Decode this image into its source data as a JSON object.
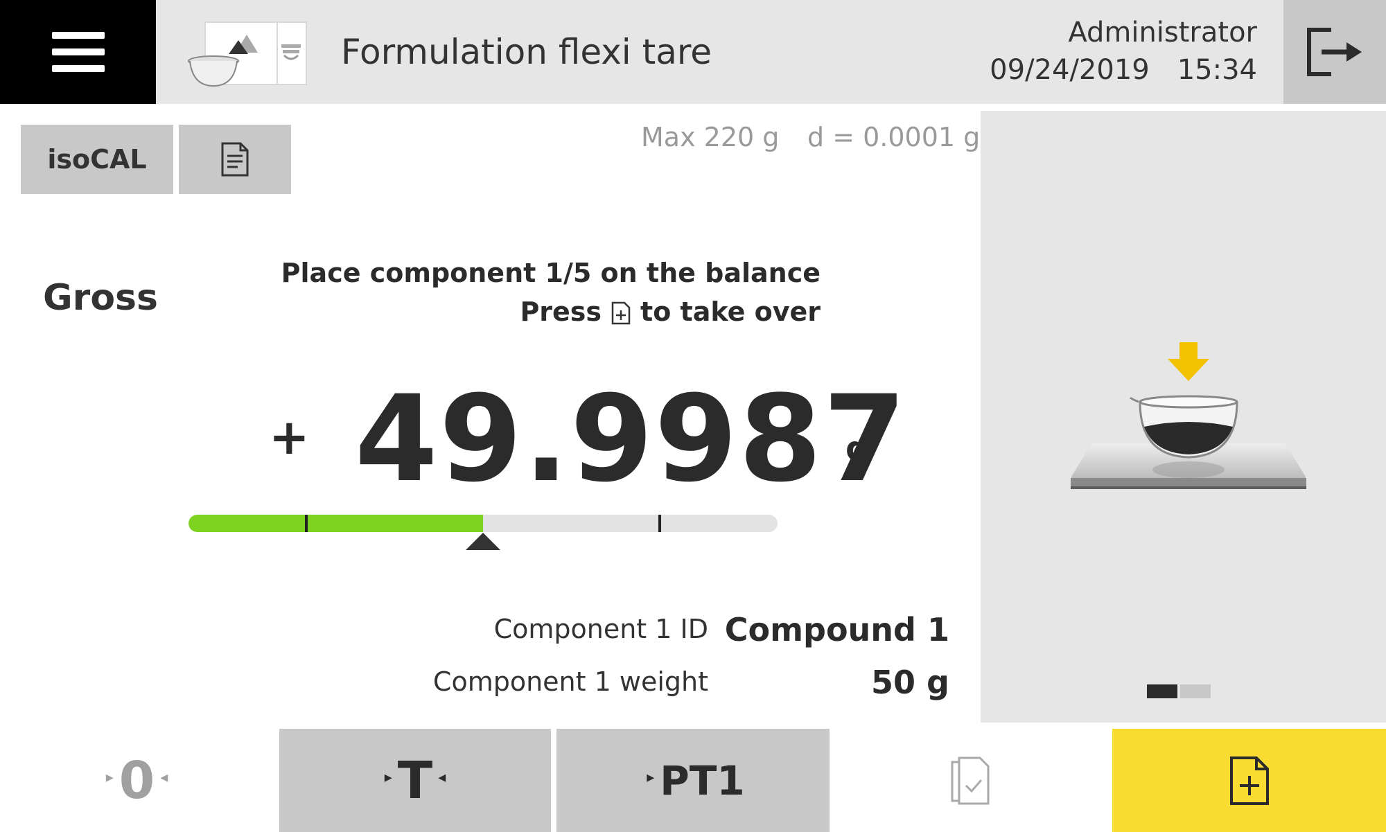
{
  "header": {
    "title": "Formulation flexi tare",
    "user": "Administrator",
    "date": "09/24/2019",
    "time": "15:34"
  },
  "toolbar_top": {
    "isocal_label": "isoCAL"
  },
  "balance_spec": {
    "max": "Max 220 g",
    "readability": "d = 0.0001 g"
  },
  "weighing": {
    "mode": "Gross",
    "instruction_line1": "Place component 1/5 on the balance",
    "instruction_press": "Press",
    "instruction_suffix": "to take over",
    "sign": "+",
    "value": "49.9987",
    "unit": "g",
    "progress_fraction": 0.5,
    "tolerance_low_fraction": 0.2,
    "tolerance_high_fraction": 0.8
  },
  "component": {
    "id_label": "Component 1 ID",
    "id_value": "Compound 1",
    "weight_label": "Component 1 weight",
    "weight_value": "50 g"
  },
  "bottom_toolbar": {
    "zero_label": "0",
    "tare_label": "T",
    "pretare_label": "PT1"
  },
  "colors": {
    "accent_yellow": "#f8dc32",
    "progress_green": "#7ed321",
    "button_gray": "#c8c8c8",
    "header_gray": "#e6e6e6"
  },
  "icons": {
    "menu": "hamburger-icon",
    "app": "formulation-app-icon",
    "logout": "logout-icon",
    "report": "document-icon",
    "results": "results-list-icon",
    "takeover": "document-add-icon",
    "illustration": "beaker-on-pan-icon"
  },
  "pager": {
    "page": 1,
    "total": 2
  }
}
